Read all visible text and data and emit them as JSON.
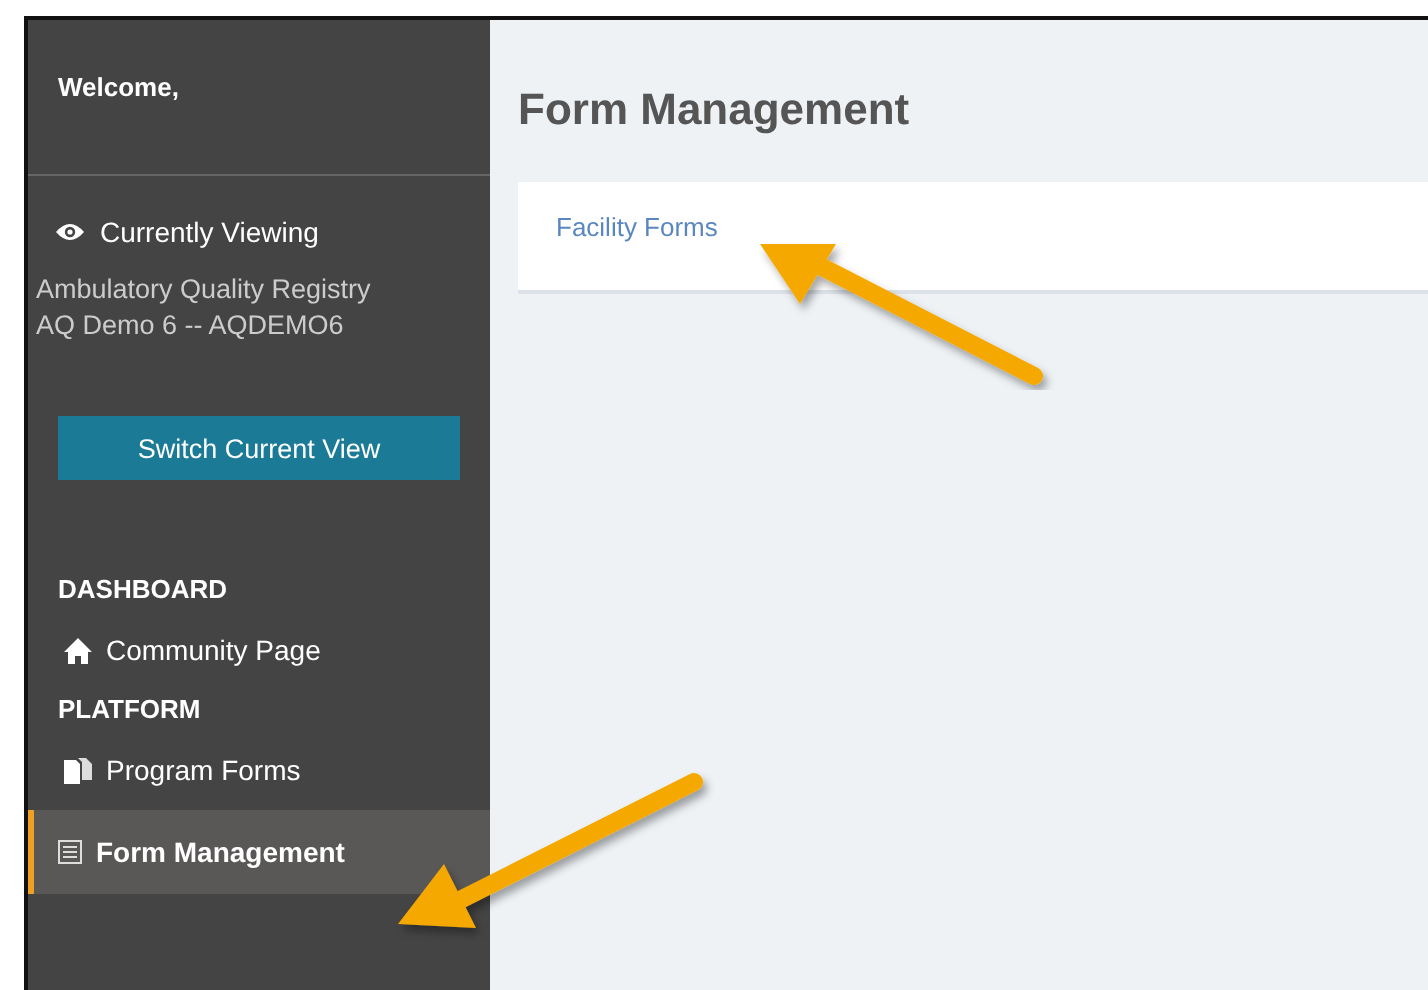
{
  "sidebar": {
    "welcome": "Welcome,",
    "viewing_label": "Currently Viewing",
    "viewing_lines": [
      "Ambulatory Quality Registry",
      "AQ Demo 6 -- AQDEMO6"
    ],
    "switch_button": "Switch Current View",
    "nav": [
      {
        "kind": "heading",
        "label": "DASHBOARD"
      },
      {
        "kind": "item",
        "label": "Community Page",
        "selected": false
      },
      {
        "kind": "heading",
        "label": "PLATFORM"
      },
      {
        "kind": "item",
        "label": "Program Forms",
        "selected": false
      },
      {
        "kind": "item",
        "label": "Form Management",
        "selected": true
      }
    ]
  },
  "main": {
    "title": "Form Management",
    "links": [
      "Facility Forms"
    ]
  }
}
